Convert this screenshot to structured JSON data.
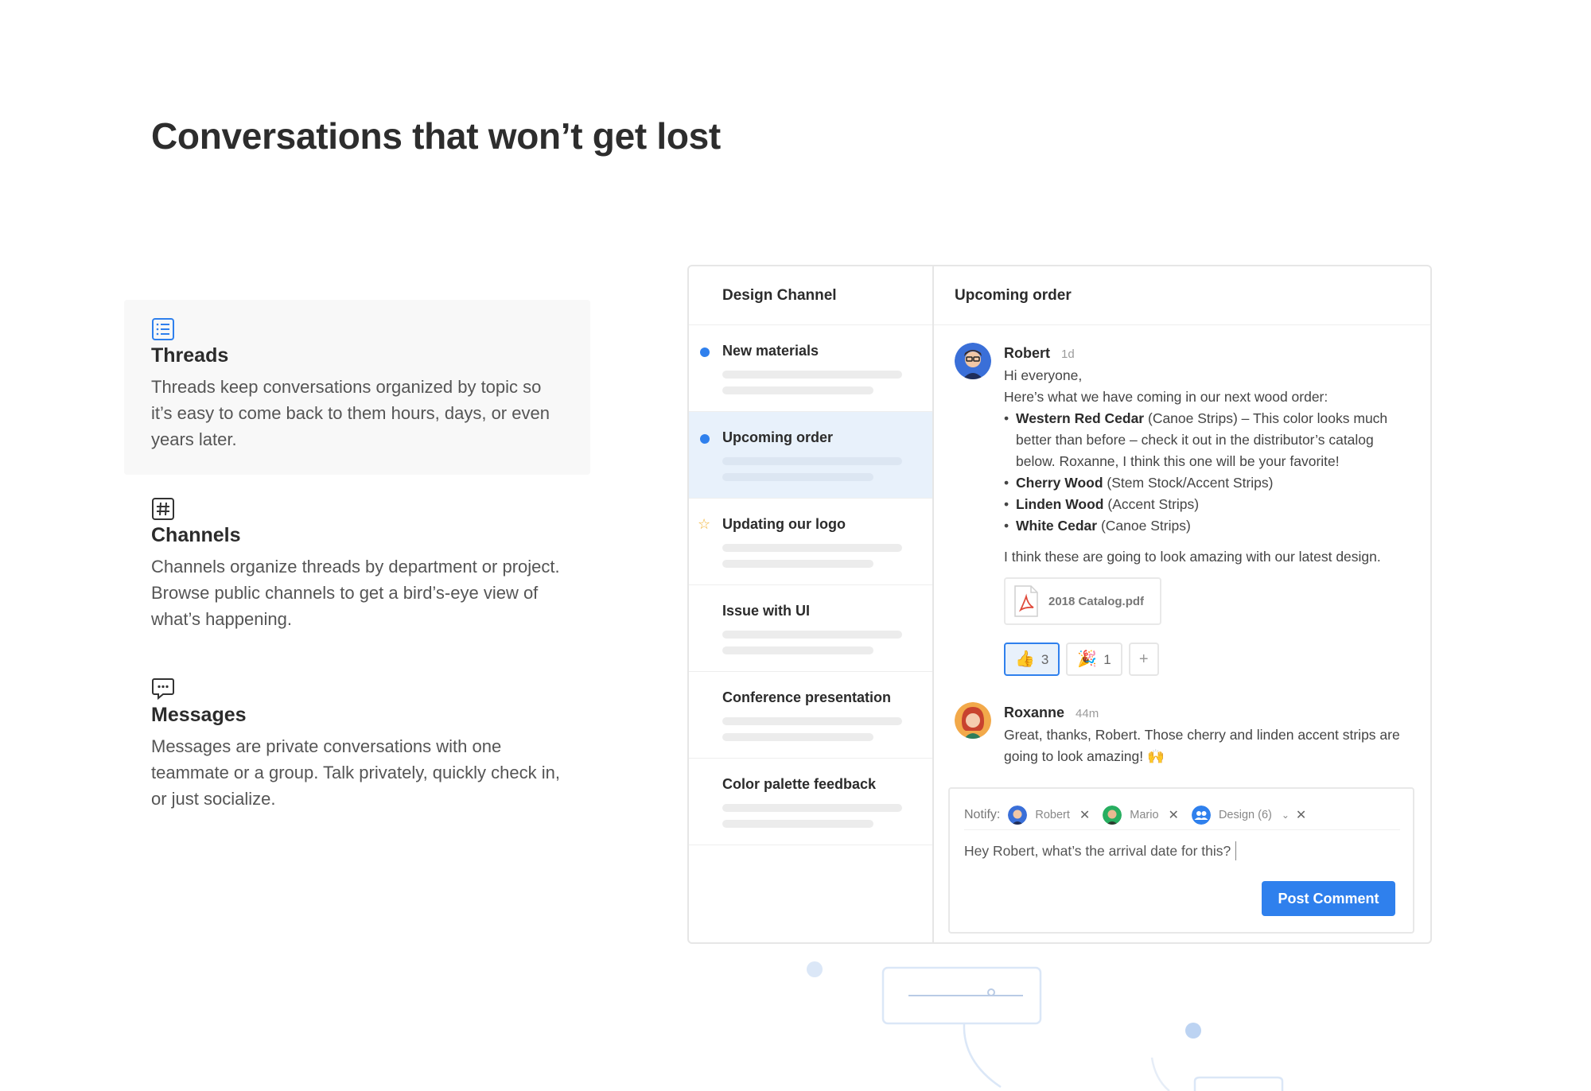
{
  "headline": "Conversations that won’t get lost",
  "features": [
    {
      "icon": "list-icon",
      "title": "Threads",
      "description": "Threads keep conversations organized by topic so it’s easy to come back to them hours, days, or even years later."
    },
    {
      "icon": "hash-icon",
      "title": "Channels",
      "description": "Channels organize threads by department or project. Browse public channels to get a bird’s-eye view of what’s happening."
    },
    {
      "icon": "chat-bubble-icon",
      "title": "Messages",
      "description": "Messages are private conversations with one teammate or a group. Talk privately, quickly check in, or just socialize."
    }
  ],
  "channel": {
    "title": "Design Channel",
    "threads": [
      {
        "name": "New materials",
        "marker": "unread-dot"
      },
      {
        "name": "Upcoming order",
        "marker": "unread-dot",
        "selected": true
      },
      {
        "name": "Updating our logo",
        "marker": "star-icon"
      },
      {
        "name": "Issue with UI"
      },
      {
        "name": "Conference presentation"
      },
      {
        "name": "Color palette feedback"
      }
    ]
  },
  "conversation": {
    "title": "Upcoming order",
    "messages": [
      {
        "author": "Robert",
        "time": "1d",
        "greeting": "Hi everyone,",
        "intro": "Here’s what we have coming in our next wood order:",
        "items": [
          {
            "bold": "Western Red Cedar",
            "rest": " (Canoe Strips) – This color looks much better than before – check it out in the distributor’s catalog below. Roxanne, I think this one will be your favorite!"
          },
          {
            "bold": "Cherry Wood",
            "rest": " (Stem Stock/Accent Strips)"
          },
          {
            "bold": "Linden Wood",
            "rest": " (Accent Strips)"
          },
          {
            "bold": "White Cedar",
            "rest": " (Canoe Strips)"
          }
        ],
        "outro": "I think these are going to look amazing with our latest design.",
        "attachment": "2018 Catalog.pdf",
        "reactions": [
          {
            "emoji": "👍",
            "count": "3",
            "mine": true
          },
          {
            "emoji": "🎉",
            "count": "1"
          }
        ],
        "add_reaction": "+"
      },
      {
        "author": "Roxanne",
        "time": "44m",
        "text": "Great, thanks, Robert. Those cherry and linden accent strips are going to look amazing! 🙌"
      }
    ]
  },
  "composer": {
    "notify_label": "Notify:",
    "recipients": [
      {
        "name": "Robert",
        "remove": "✕"
      },
      {
        "name": "Mario",
        "remove": "✕"
      },
      {
        "name": "Design (6)",
        "caret": "⌄",
        "remove": "✕"
      }
    ],
    "text": "Hey Robert, what’s the arrival date for this?",
    "post_label": "Post Comment"
  },
  "colors": {
    "accent": "#2f80ed",
    "selected_bg": "#e8f1fb",
    "star": "#f2b53a"
  }
}
